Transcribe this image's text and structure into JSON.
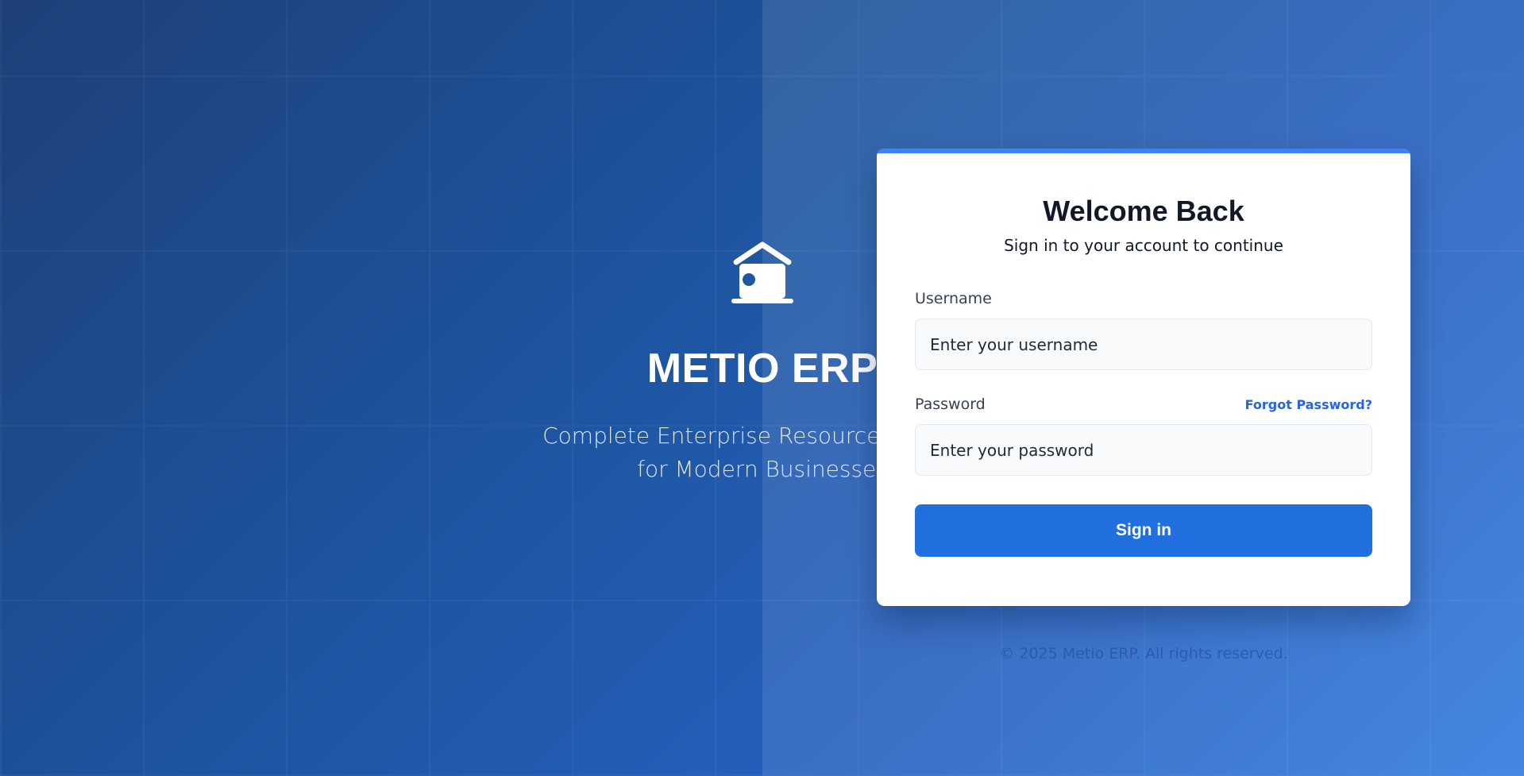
{
  "hero": {
    "logo_icon": "warehouse-icon",
    "title": "METIO ERP",
    "subtitle_line1": "Complete Enterprise Resource Planning",
    "subtitle_line2": "for Modern Businesses"
  },
  "login": {
    "title": "Welcome Back",
    "subtitle": "Sign in to your account to continue",
    "username_label": "Username",
    "username_placeholder": "Enter your username",
    "username_value": "",
    "password_label": "Password",
    "password_placeholder": "Enter your password",
    "password_value": "",
    "forgot_password": "Forgot Password?",
    "submit_label": "Sign in"
  },
  "footer": {
    "copyright": "© 2025 Metio ERP. All rights reserved."
  },
  "colors": {
    "primary": "#2170e0",
    "accent_bar": "#3b82f6",
    "background_start": "#1d4079",
    "background_end": "#2f7ae0"
  }
}
